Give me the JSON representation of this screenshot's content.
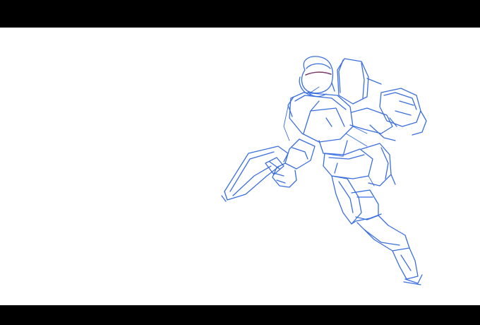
{
  "scene": {
    "letterbox_color": "#000000",
    "canvas_color": "#ffffff",
    "sketch_color": "#3a6fe0",
    "visor_color": "#7a3a6a",
    "subject": "blue-line-sketch-armored-robot-with-sword"
  }
}
